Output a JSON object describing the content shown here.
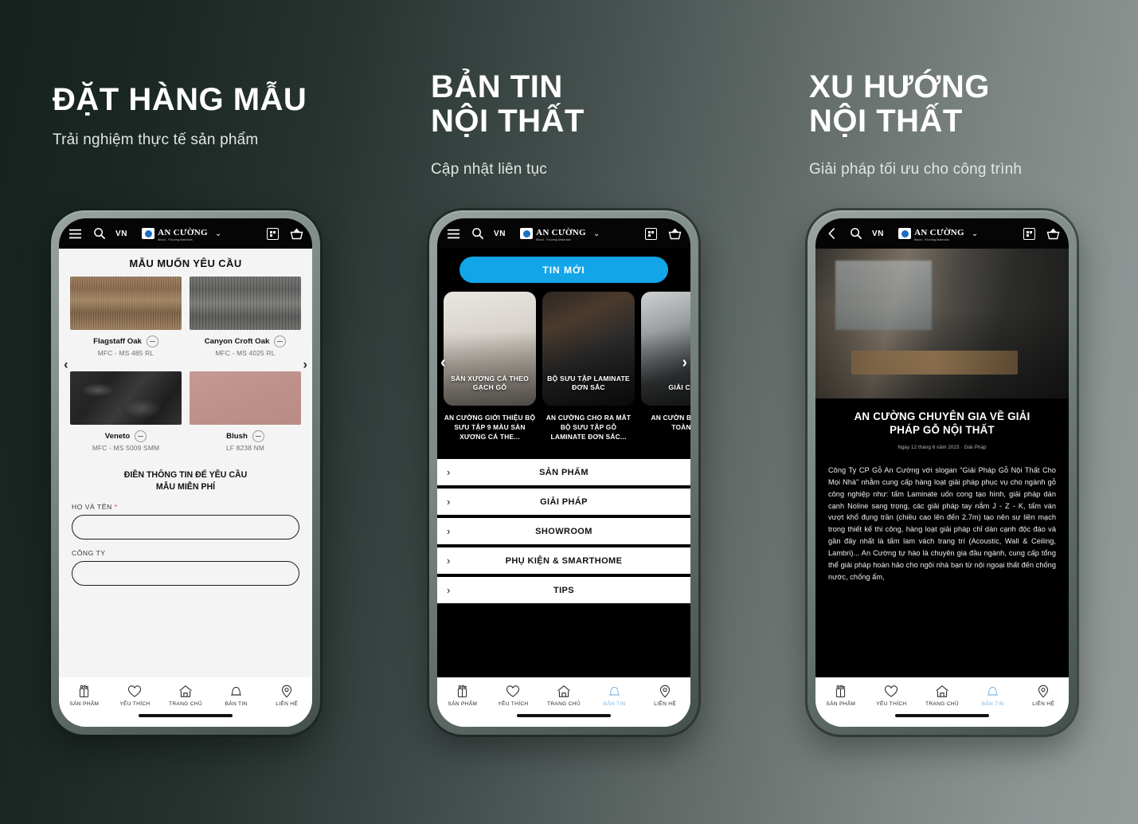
{
  "background": {
    "gradient_from": "#16221e",
    "gradient_to": "#949c99"
  },
  "accent": {
    "blue": "#12a5e8",
    "tab_active": "#7fb5e0",
    "required": "#e03b2f"
  },
  "headings": [
    {
      "title": "ĐẶT HÀNG MẪU",
      "subtitle": "Trải nghiệm thực tế sản phẩm"
    },
    {
      "title": "BẢN TIN\nNỘI THẤT",
      "subtitle": "Cập nhật liên tục"
    },
    {
      "title": "XU HƯỚNG\nNỘI THẤT",
      "subtitle": "Giải pháp tối ưu cho công trình"
    }
  ],
  "appbar": {
    "menu_icon": "hamburger-icon",
    "back_icon": "chevron-left-icon",
    "search_icon": "search-icon",
    "language": "VN",
    "brand_name": "AN CƯỜNG",
    "brand_reg": "®",
    "brand_tagline": "Wood - Flooring Materials",
    "dropdown_icon": "chevron-down-icon",
    "qr_icon": "qr-scan-icon",
    "cart_icon": "basket-icon"
  },
  "phone1": {
    "title": "MẪU MUỐN YÊU CẦU",
    "prev_arrow": "‹",
    "next_arrow": "›",
    "samples": [
      {
        "name": "Flagstaff Oak",
        "code": "MFC - MS 485 RL",
        "swatch": "sw-flagstaff"
      },
      {
        "name": "Canyon Croft Oak",
        "code": "MFC - MS 4025 RL",
        "swatch": "sw-canyon"
      },
      {
        "name": "Veneto",
        "code": "MFC - MS 5009 SMM",
        "swatch": "sw-veneto"
      },
      {
        "name": "Blush",
        "code": "LF 8238 NM",
        "swatch": "sw-blush"
      }
    ],
    "form_title": "ĐIỀN THÔNG TIN ĐỂ YÊU CẦU\nMẪU MIỄN PHÍ",
    "fields": [
      {
        "label": "HỌ VÀ TÊN",
        "required": true,
        "value": ""
      },
      {
        "label": "CÔNG TY",
        "required": false,
        "value": ""
      }
    ]
  },
  "phone2": {
    "cta_label": "TIN MỚI",
    "prev_arrow": "‹",
    "next_arrow": "›",
    "news": [
      {
        "caption": "SÀN XƯƠNG CÁ\nTHEO GẠCH GỖ",
        "summary": "AN CƯỜNG GIỚI THIỆU\nBỘ SƯU TẬP 9 MÀU\nSÀN XƯƠNG CÁ THE...",
        "thumb": "nt1"
      },
      {
        "caption": "BỘ SƯU TẬP\nLAMINATE ĐƠN\nSẮC",
        "summary": "AN CƯỜNG CHO RA\nMẮT BỘ SƯU TẬP GỖ\nLAMINATE ĐƠN SẮC...",
        "thumb": "nt2"
      },
      {
        "caption": "GIẢI\nCHỐN",
        "summary": "AN CƯỜN\nBOARD - G\nTOÀN CH",
        "thumb": "nt3"
      }
    ],
    "menu": [
      {
        "label": "SẢN PHẨM"
      },
      {
        "label": "GIẢI PHÁP"
      },
      {
        "label": "SHOWROOM"
      },
      {
        "label": "PHỤ KIỆN & SMARTHOME"
      },
      {
        "label": "TIPS"
      }
    ]
  },
  "phone3": {
    "article_title": "AN CƯỜNG CHUYÊN GIA VỀ GIẢI\nPHÁP GỖ NỘI THẤT",
    "article_date": "Ngày 12 tháng 6 năm 2023 · Giải Pháp",
    "article_body": "Công Ty CP Gỗ An Cường với slogan \"Giải Pháp Gỗ Nội Thất Cho Mọi Nhà\" nhằm cung cấp hàng loạt giải pháp phục vụ cho ngành gỗ công nghiệp như: tấm Laminate uốn cong tạo hình, giải pháp dán cạnh Noline sang trọng, các giải pháp tay nắm J - Z - K, tấm ván vượt khổ đụng trần (chiều cao lên đến 2.7m) tạo nên sự liền mạch trong thiết kế thi công, hàng loạt giải pháp chỉ dán cạnh độc đáo và gần đây nhất là tấm lam vách trang trí (Acoustic, Wall & Ceiling, Lambri)... An Cường tự hào là chuyên gia đầu ngành, cung cấp tổng thể giải pháp hoàn hảo cho ngôi nhà bạn từ nội ngoại thất đến chống nước, chống ẩm,"
  },
  "tabbar": {
    "items": [
      {
        "label": "SẢN PHẨM",
        "icon": "product-box-icon",
        "active": false
      },
      {
        "label": "YÊU THÍCH",
        "icon": "heart-icon",
        "active": false
      },
      {
        "label": "TRANG CHỦ",
        "icon": "home-icon",
        "active": false
      },
      {
        "label": "BẢN TIN",
        "icon": "bell-icon",
        "active": false
      },
      {
        "label": "LIÊN HỆ",
        "icon": "location-pin-icon",
        "active": false
      }
    ],
    "items_news_active": [
      {
        "label": "SẢN PHẨM",
        "icon": "product-box-icon",
        "active": false
      },
      {
        "label": "YÊU THÍCH",
        "icon": "heart-icon",
        "active": false
      },
      {
        "label": "TRANG CHỦ",
        "icon": "home-icon",
        "active": false
      },
      {
        "label": "BẢN TIN",
        "icon": "bell-icon",
        "active": true
      },
      {
        "label": "LIÊN HỆ",
        "icon": "location-pin-icon",
        "active": false
      }
    ]
  }
}
